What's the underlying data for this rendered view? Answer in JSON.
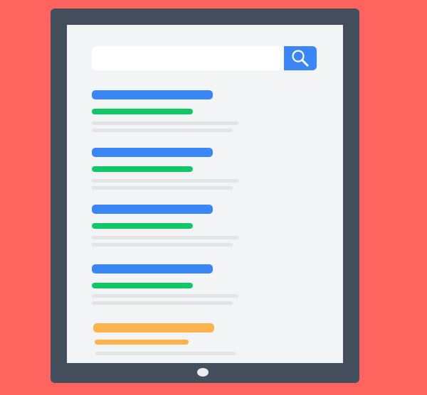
{
  "search": {
    "value": "",
    "placeholder": "",
    "button_icon": "search-icon"
  },
  "results": [
    {
      "kind": "result",
      "title": "",
      "url": "",
      "snippet_lines": [
        "",
        ""
      ]
    },
    {
      "kind": "result",
      "title": "",
      "url": "",
      "snippet_lines": [
        "",
        ""
      ]
    },
    {
      "kind": "result",
      "title": "",
      "url": "",
      "snippet_lines": [
        "",
        ""
      ]
    },
    {
      "kind": "result",
      "title": "",
      "url": "",
      "snippet_lines": [
        "",
        ""
      ]
    },
    {
      "kind": "ad",
      "title": "",
      "url": "",
      "snippet_lines": [
        ""
      ]
    }
  ],
  "colors": {
    "background": "#ff645e",
    "device_frame": "#444f5e",
    "screen": "#f3f4f6",
    "search_button": "#3b86f7",
    "result_title": "#3b86f7",
    "result_url": "#0ec765",
    "ad_title": "#ffb34f",
    "snippet": "#e3e4e6",
    "home_button": "#ececec"
  }
}
